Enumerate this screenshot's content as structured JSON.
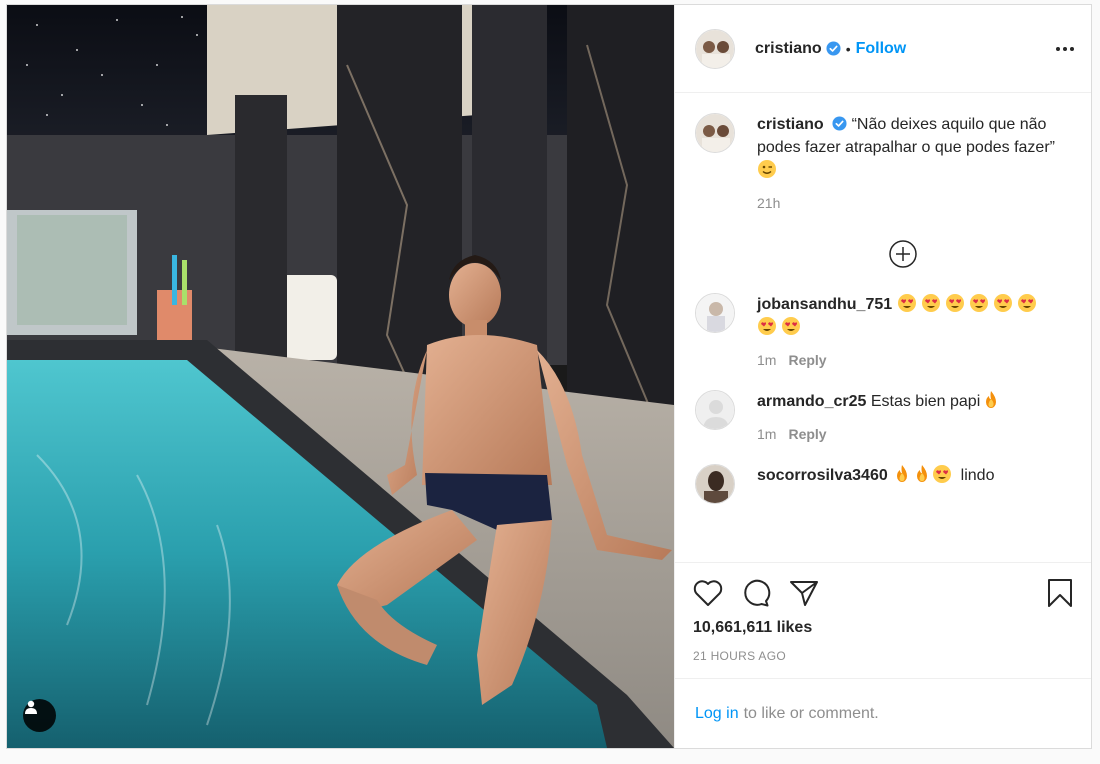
{
  "header": {
    "username": "cristiano",
    "follow_label": "Follow",
    "separator": "•"
  },
  "caption": {
    "username": "cristiano",
    "text": "“Não deixes aquilo que não podes fazer atrapalhar o que podes fazer”",
    "emoji": "wink",
    "time": "21h"
  },
  "comments": [
    {
      "username": "jobansandhu_751",
      "text": "",
      "emojis": [
        "heart-eyes",
        "heart-eyes",
        "heart-eyes",
        "heart-eyes",
        "heart-eyes",
        "heart-eyes",
        "heart-eyes",
        "heart-eyes"
      ],
      "time": "1m",
      "reply_label": "Reply"
    },
    {
      "username": "armando_cr25",
      "text": "Estas bien papi",
      "emojis": [
        "fire"
      ],
      "time": "1m",
      "reply_label": "Reply"
    },
    {
      "username": "socorrosilva3460",
      "text": "lindo",
      "emojis": [
        "fire",
        "fire",
        "heart-eyes"
      ],
      "time": "",
      "reply_label": ""
    }
  ],
  "stats": {
    "likes": "10,661,611 likes",
    "posted": "21 HOURS AGO"
  },
  "login": {
    "link_label": "Log in",
    "suffix": "to like or comment."
  },
  "colors": {
    "accent": "#0095f6",
    "muted": "#8e8e8e",
    "text": "#262626",
    "verified": "#3897f0"
  },
  "icons": [
    "verified-badge-icon",
    "more-options-icon",
    "add-comment-icon",
    "heart-icon",
    "comment-icon",
    "share-icon",
    "bookmark-icon",
    "user-tag-icon"
  ]
}
